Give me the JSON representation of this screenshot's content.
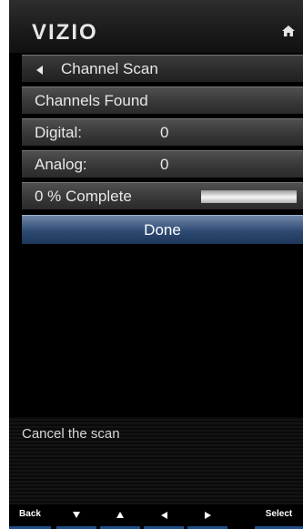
{
  "header": {
    "logo": "VIZIO",
    "home_icon": "home-icon"
  },
  "menu": {
    "title": "Channel Scan",
    "rows": [
      {
        "label": "Channels Found",
        "value": ""
      },
      {
        "label": "Digital:",
        "value": "0"
      },
      {
        "label": "Analog:",
        "value": "0"
      }
    ],
    "progress": {
      "label": "0 % Complete",
      "fraction": 0
    },
    "done_label": "Done"
  },
  "help": {
    "text": "Cancel the scan"
  },
  "bottom_bar": {
    "back": "Back",
    "select": "Select",
    "icons": [
      "down-arrow-icon",
      "up-arrow-icon",
      "left-arrow-icon",
      "right-arrow-icon"
    ]
  },
  "colors": {
    "highlight": "#2e4a73",
    "button_underline": "#1f4f8a"
  }
}
